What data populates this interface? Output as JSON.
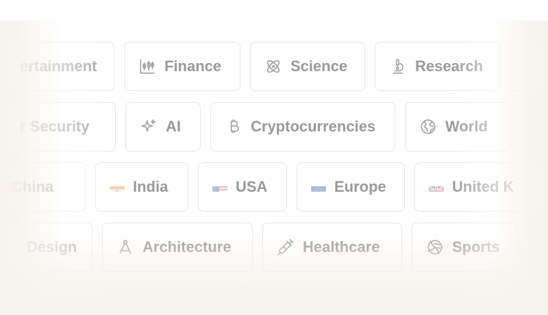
{
  "topics": {
    "row1": [
      {
        "label": "ertainment",
        "icon": "entertainment-icon"
      },
      {
        "label": "Finance",
        "icon": "candlestick-chart-icon"
      },
      {
        "label": "Science",
        "icon": "atom-icon"
      },
      {
        "label": "Research",
        "icon": "microscope-icon"
      }
    ],
    "row2": [
      {
        "label": "r Security",
        "icon": "security-icon"
      },
      {
        "label": "AI",
        "icon": "sparkles-icon"
      },
      {
        "label": "Cryptocurrencies",
        "icon": "bitcoin-icon"
      },
      {
        "label": "World",
        "icon": "globe-icon"
      }
    ],
    "row3": [
      {
        "label": "China",
        "icon": "china-flag-icon"
      },
      {
        "label": "India",
        "icon": "india-flag-icon"
      },
      {
        "label": "USA",
        "icon": "usa-flag-icon"
      },
      {
        "label": "Europe",
        "icon": "eu-flag-icon"
      },
      {
        "label": "United K",
        "icon": "uk-flag-icon"
      }
    ],
    "row4": [
      {
        "label": "Design",
        "icon": "design-icon"
      },
      {
        "label": "Architecture",
        "icon": "compass-icon"
      },
      {
        "label": "Healthcare",
        "icon": "syringe-icon"
      },
      {
        "label": "Sports",
        "icon": "volleyball-icon"
      }
    ]
  },
  "colors": {
    "text": "#9a9a9a",
    "icon": "#a5a5a5",
    "border": "#e7e6e4",
    "background": "#f7f4ef"
  }
}
